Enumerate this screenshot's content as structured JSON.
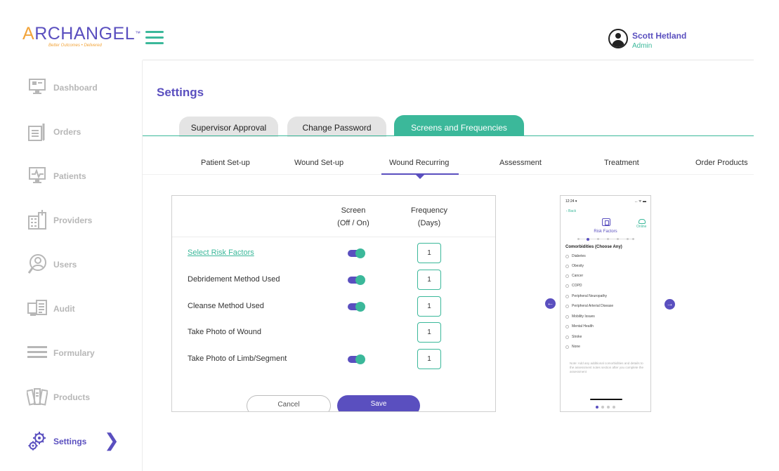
{
  "header": {
    "logo_word": "ARCHANGEL",
    "logo_tm": "™",
    "logo_tagline": "Better Outcomes • Delivered",
    "user_name": "Scott Hetland",
    "user_role": "Admin"
  },
  "sidebar": {
    "items": [
      {
        "label": "Dashboard",
        "icon": "monitor-icon"
      },
      {
        "label": "Orders",
        "icon": "orders-icon"
      },
      {
        "label": "Patients",
        "icon": "patients-icon"
      },
      {
        "label": "Providers",
        "icon": "providers-icon"
      },
      {
        "label": "Users",
        "icon": "user-icon"
      },
      {
        "label": "Audit",
        "icon": "audit-icon"
      },
      {
        "label": "Formulary",
        "icon": "list-icon"
      },
      {
        "label": "Products",
        "icon": "products-icon"
      },
      {
        "label": "Settings",
        "icon": "gear-icon"
      }
    ],
    "active": "Settings",
    "chevron": "❯"
  },
  "main": {
    "title": "Settings",
    "tabs": [
      "Supervisor Approval",
      "Change Password",
      "Screens and Frequencies"
    ],
    "active_tab": "Screens and Frequencies",
    "subtabs": [
      "Patient Set-up",
      "Wound Set-up",
      "Wound Recurring",
      "Assessment",
      "Treatment",
      "Order Products"
    ],
    "active_subtab": "Wound Recurring"
  },
  "panel": {
    "col_screen_1": "Screen",
    "col_screen_2": "(Off / On)",
    "col_freq_1": "Frequency",
    "col_freq_2": "(Days)",
    "rows": [
      {
        "label": "Select Risk Factors",
        "link": true,
        "screen_on": true,
        "frequency": "1"
      },
      {
        "label": "Debridement Method Used",
        "link": false,
        "screen_on": true,
        "frequency": "1"
      },
      {
        "label": "Cleanse Method Used",
        "link": false,
        "screen_on": true,
        "frequency": "1"
      },
      {
        "label": "Take Photo of Wound",
        "link": false,
        "screen_on": false,
        "frequency": "1"
      },
      {
        "label": "Take Photo of Limb/Segment",
        "link": false,
        "screen_on": true,
        "frequency": "1"
      }
    ],
    "cancel_label": "Cancel",
    "save_label": "Save"
  },
  "preview": {
    "prev_arrow": "←",
    "next_arrow": "→",
    "time": "12:24 ▾",
    "status": "... ᯤ ▬",
    "back": "‹ Back",
    "online": "Online",
    "screen_title": "Risk Factors",
    "heading": "Comorbidities (Choose Any)",
    "options": [
      "Diabetes",
      "Obesity",
      "Cancer",
      "COPD",
      "Peripheral Neuropathy",
      "Peripheral Arterial Disease",
      "Mobility Issues",
      "Mental Health",
      "Stroke",
      "None"
    ],
    "note": "Note:\nAdd any additional comorbidities and details to the assessment  notes section after you complete the assessment"
  },
  "colors": {
    "brand_purple": "#5a4fbf",
    "brand_teal": "#3bb89a",
    "logo_orange": "#f2a43a"
  }
}
